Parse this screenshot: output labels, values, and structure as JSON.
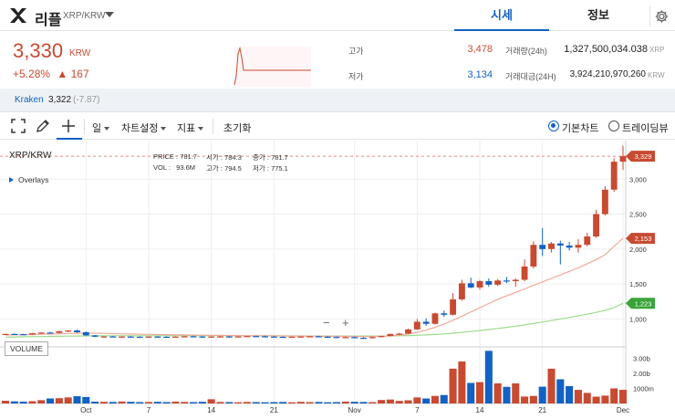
{
  "header": {
    "coin_name": "리플",
    "coin_pair": "XRP/KRW",
    "tabs": [
      {
        "label": "시세",
        "active": true
      },
      {
        "label": "정보",
        "active": false
      }
    ]
  },
  "summary": {
    "price": "3,330",
    "price_unit": "KRW",
    "change_pct": "+5.28%",
    "change_arrow": "▲",
    "change_abs": "167",
    "high_label": "고가",
    "high_value": "3,478",
    "low_label": "저가",
    "low_value": "3,134",
    "volume_label": "거래량(24h)",
    "volume_value": "1,327,500,034.038",
    "volume_unit": "XRP",
    "amount_label": "거래대금(24H)",
    "amount_value": "3,924,210,970,260",
    "amount_unit": "KRW",
    "up_color": "#c84a31",
    "down_color": "#1261c4"
  },
  "exchange": {
    "name": "Kraken",
    "price": "3,322",
    "diff": "(-7.87)"
  },
  "toolbar": {
    "period_label": "일",
    "chart_settings_label": "차트설정",
    "indicator_label": "지표",
    "reset_label": "초기화",
    "basic_chart_label": "기본차트",
    "trading_view_label": "트레이딩뷰",
    "basic_chart_selected": true
  },
  "chart_legend": {
    "symbol": "XRP/KRW",
    "price_label": "PRICE",
    "price_value": "781.7",
    "open_label": "시가",
    "open_value": "784.3",
    "close_label": "종가",
    "close_value": "781.7",
    "vol_label": "VOL",
    "vol_value": "93.6M",
    "high_label": "고가",
    "high_value": "794.5",
    "low_label": "저가",
    "low_value": "775.1",
    "overlays_label": "Overlays",
    "volume_box_label": "VOLUME",
    "zoom_out": "−",
    "zoom_in": "+"
  },
  "chart_data": {
    "type": "candlestick",
    "price_axis_ticks": [
      "3,000",
      "2,500",
      "2,000",
      "1,500",
      "1,000"
    ],
    "price_axis_values": [
      3000,
      2500,
      2000,
      1500,
      1000
    ],
    "volume_axis_ticks": [
      "3.00b",
      "2.00b",
      "1000m"
    ],
    "volume_axis_values": [
      3000,
      2000,
      1000
    ],
    "x_tick_labels": [
      "Oct",
      "7",
      "14",
      "21",
      "Nov",
      "7",
      "14",
      "21",
      "Dec"
    ],
    "x_tick_index": [
      9,
      16,
      23,
      30,
      39,
      46,
      53,
      60,
      69
    ],
    "price_ylim": [
      600,
      3500
    ],
    "volume_ylim": [
      0,
      3500
    ],
    "last_price_badge": "3,329",
    "ma_short_badge": "2,153",
    "ma_long_badge": "1,223",
    "current_price": 3329,
    "ma_short_last": 2153,
    "ma_long_last": 1223,
    "candles": [
      [
        780,
        790,
        770,
        785
      ],
      [
        785,
        792,
        775,
        782
      ],
      [
        782,
        788,
        770,
        778
      ],
      [
        778,
        800,
        770,
        795
      ],
      [
        795,
        810,
        785,
        805
      ],
      [
        805,
        815,
        790,
        800
      ],
      [
        800,
        830,
        795,
        825
      ],
      [
        825,
        840,
        810,
        835
      ],
      [
        835,
        845,
        800,
        810
      ],
      [
        810,
        820,
        760,
        765
      ],
      [
        765,
        770,
        740,
        745
      ],
      [
        745,
        755,
        735,
        750
      ],
      [
        750,
        755,
        738,
        742
      ],
      [
        742,
        752,
        736,
        748
      ],
      [
        748,
        755,
        738,
        745
      ],
      [
        745,
        752,
        735,
        740
      ],
      [
        740,
        750,
        735,
        748
      ],
      [
        748,
        755,
        740,
        745
      ],
      [
        745,
        752,
        738,
        742
      ],
      [
        742,
        750,
        735,
        746
      ],
      [
        746,
        755,
        740,
        752
      ],
      [
        752,
        760,
        744,
        748
      ],
      [
        748,
        755,
        740,
        744
      ],
      [
        744,
        752,
        738,
        748
      ],
      [
        748,
        756,
        742,
        750
      ],
      [
        750,
        758,
        742,
        746
      ],
      [
        746,
        754,
        740,
        750
      ],
      [
        750,
        758,
        744,
        755
      ],
      [
        755,
        762,
        748,
        752
      ],
      [
        752,
        760,
        745,
        748
      ],
      [
        748,
        756,
        740,
        744
      ],
      [
        744,
        752,
        738,
        742
      ],
      [
        742,
        750,
        735,
        745
      ],
      [
        745,
        752,
        738,
        748
      ],
      [
        748,
        756,
        742,
        752
      ],
      [
        752,
        760,
        744,
        746
      ],
      [
        746,
        754,
        738,
        742
      ],
      [
        742,
        750,
        730,
        735
      ],
      [
        735,
        745,
        728,
        740
      ],
      [
        740,
        748,
        725,
        730
      ],
      [
        730,
        740,
        720,
        725
      ],
      [
        725,
        745,
        720,
        740
      ],
      [
        740,
        760,
        735,
        755
      ],
      [
        755,
        790,
        750,
        785
      ],
      [
        785,
        800,
        770,
        790
      ],
      [
        790,
        860,
        785,
        850
      ],
      [
        850,
        1000,
        840,
        960
      ],
      [
        960,
        1010,
        900,
        930
      ],
      [
        930,
        1090,
        920,
        1080
      ],
      [
        1080,
        1120,
        1030,
        1060
      ],
      [
        1060,
        1370,
        1050,
        1280
      ],
      [
        1280,
        1560,
        1260,
        1510
      ],
      [
        1510,
        1590,
        1440,
        1450
      ],
      [
        1450,
        1560,
        1420,
        1540
      ],
      [
        1540,
        1580,
        1460,
        1490
      ],
      [
        1490,
        1570,
        1470,
        1550
      ],
      [
        1550,
        1600,
        1510,
        1540
      ],
      [
        1540,
        1580,
        1460,
        1560
      ],
      [
        1560,
        1850,
        1540,
        1750
      ],
      [
        1750,
        2110,
        1720,
        2060
      ],
      [
        2060,
        2300,
        1900,
        2000
      ],
      [
        2000,
        2100,
        1950,
        2080
      ],
      [
        2080,
        2120,
        1780,
        2050
      ],
      [
        2050,
        2100,
        1980,
        2020
      ],
      [
        2020,
        2140,
        1950,
        2060
      ],
      [
        2060,
        2230,
        2040,
        2180
      ],
      [
        2180,
        2560,
        2160,
        2500
      ],
      [
        2500,
        2900,
        2480,
        2850
      ],
      [
        2850,
        3300,
        2820,
        3250
      ],
      [
        3250,
        3478,
        3134,
        3329
      ]
    ],
    "volumes": [
      180,
      140,
      120,
      150,
      220,
      330,
      350,
      400,
      480,
      430,
      120,
      110,
      100,
      130,
      110,
      90,
      100,
      110,
      90,
      120,
      100,
      90,
      110,
      280,
      100,
      90,
      80,
      100,
      90,
      80,
      90,
      100,
      80,
      110,
      90,
      100,
      80,
      90,
      120,
      110,
      100,
      90,
      230,
      260,
      170,
      210,
      400,
      330,
      500,
      560,
      2300,
      2780,
      1360,
      1410,
      3480,
      1330,
      1100,
      1330,
      460,
      500,
      1110,
      2300,
      1600,
      1150,
      900,
      700,
      450,
      520,
      1000,
      900
    ],
    "ma_short": [
      770,
      772,
      774,
      776,
      780,
      784,
      788,
      792,
      795,
      796,
      795,
      793,
      790,
      787,
      784,
      781,
      779,
      777,
      775,
      773,
      771,
      769,
      767,
      765,
      764,
      763,
      762,
      761,
      760,
      759,
      758,
      757,
      756,
      755,
      754,
      753,
      752,
      751,
      750,
      749,
      748,
      749,
      752,
      758,
      768,
      784,
      808,
      840,
      880,
      925,
      980,
      1040,
      1100,
      1160,
      1220,
      1280,
      1330,
      1380,
      1430,
      1480,
      1530,
      1580,
      1630,
      1680,
      1730,
      1790,
      1850,
      1920,
      2040,
      2153
    ],
    "ma_long": [
      740,
      742,
      744,
      746,
      748,
      750,
      752,
      754,
      756,
      757,
      758,
      759,
      759,
      760,
      760,
      760,
      760,
      760,
      760,
      760,
      760,
      760,
      760,
      760,
      760,
      759,
      759,
      759,
      758,
      758,
      758,
      757,
      757,
      757,
      756,
      756,
      756,
      755,
      755,
      755,
      755,
      755,
      756,
      757,
      759,
      762,
      766,
      771,
      778,
      786,
      796,
      808,
      820,
      834,
      848,
      864,
      880,
      897,
      915,
      935,
      955,
      976,
      998,
      1020,
      1044,
      1068,
      1094,
      1122,
      1160,
      1223
    ]
  }
}
